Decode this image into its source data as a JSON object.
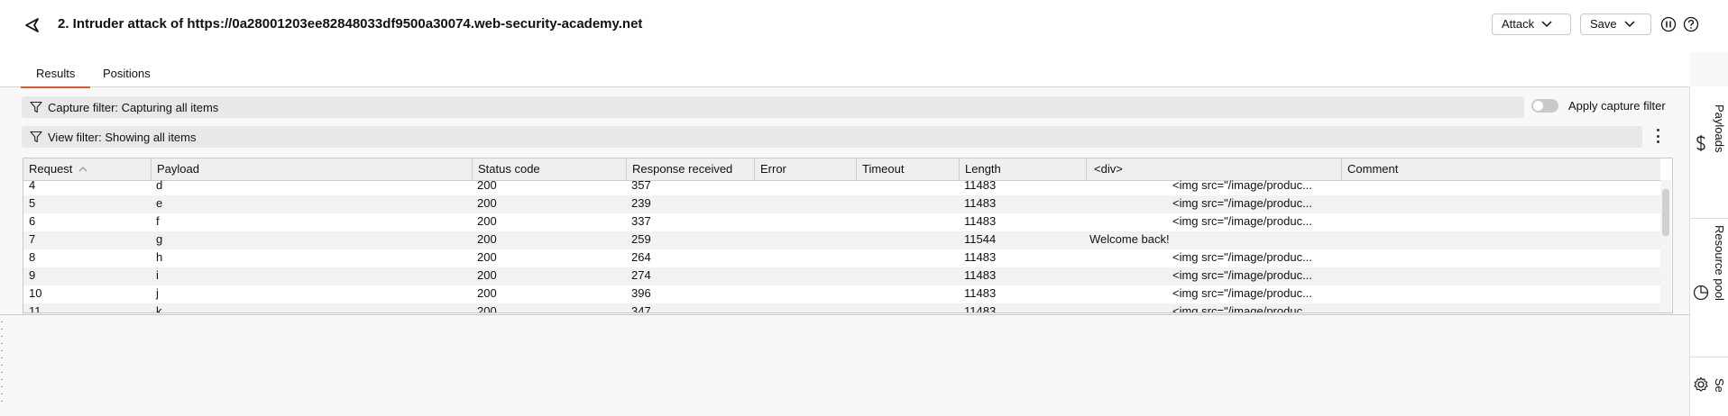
{
  "header": {
    "title": "2. Intruder attack of https://0a28001203ee82848033df9500a30074.web-security-academy.net",
    "attack_label": "Attack",
    "save_label": "Save"
  },
  "tabs": [
    {
      "label": "Results",
      "active": true
    },
    {
      "label": "Positions",
      "active": false
    }
  ],
  "capture_filter": {
    "label": "Capture filter: Capturing all items"
  },
  "apply_capture_filter": {
    "label": "Apply capture filter",
    "enabled": false
  },
  "view_filter": {
    "label": "View filter: Showing all items"
  },
  "table": {
    "columns": [
      "Request",
      "Payload",
      "Status code",
      "Response received",
      "Error",
      "Timeout",
      "Length",
      "<div>",
      "Comment"
    ],
    "rows": [
      {
        "request": "4",
        "payload": "d",
        "status": "200",
        "received": "357",
        "error": "",
        "timeout": "",
        "length": "11483",
        "div": "<img src=\"/image/produc...",
        "comment": ""
      },
      {
        "request": "5",
        "payload": "e",
        "status": "200",
        "received": "239",
        "error": "",
        "timeout": "",
        "length": "11483",
        "div": "<img src=\"/image/produc...",
        "comment": ""
      },
      {
        "request": "6",
        "payload": "f",
        "status": "200",
        "received": "337",
        "error": "",
        "timeout": "",
        "length": "11483",
        "div": "<img src=\"/image/produc...",
        "comment": ""
      },
      {
        "request": "7",
        "payload": "g",
        "status": "200",
        "received": "259",
        "error": "",
        "timeout": "",
        "length": "11544",
        "div": "Welcome back!",
        "comment": ""
      },
      {
        "request": "8",
        "payload": "h",
        "status": "200",
        "received": "264",
        "error": "",
        "timeout": "",
        "length": "11483",
        "div": "<img src=\"/image/produc...",
        "comment": ""
      },
      {
        "request": "9",
        "payload": "i",
        "status": "200",
        "received": "274",
        "error": "",
        "timeout": "",
        "length": "11483",
        "div": "<img src=\"/image/produc...",
        "comment": ""
      },
      {
        "request": "10",
        "payload": "j",
        "status": "200",
        "received": "396",
        "error": "",
        "timeout": "",
        "length": "11483",
        "div": "<img src=\"/image/produc...",
        "comment": ""
      },
      {
        "request": "11",
        "payload": "k",
        "status": "200",
        "received": "347",
        "error": "",
        "timeout": "",
        "length": "11483",
        "div": "<img src=\"/image/produc...",
        "comment": ""
      }
    ]
  },
  "right_panel": {
    "items": [
      {
        "label": "Payloads",
        "icon": "dollar-icon"
      },
      {
        "label": "Resource pool",
        "icon": "pie-chart-icon"
      },
      {
        "label": "Se",
        "icon": "gear-icon"
      }
    ]
  },
  "colors": {
    "accent": "#e8571f",
    "header_bg": "#efefef",
    "filter_bg": "#e8e8e8"
  }
}
